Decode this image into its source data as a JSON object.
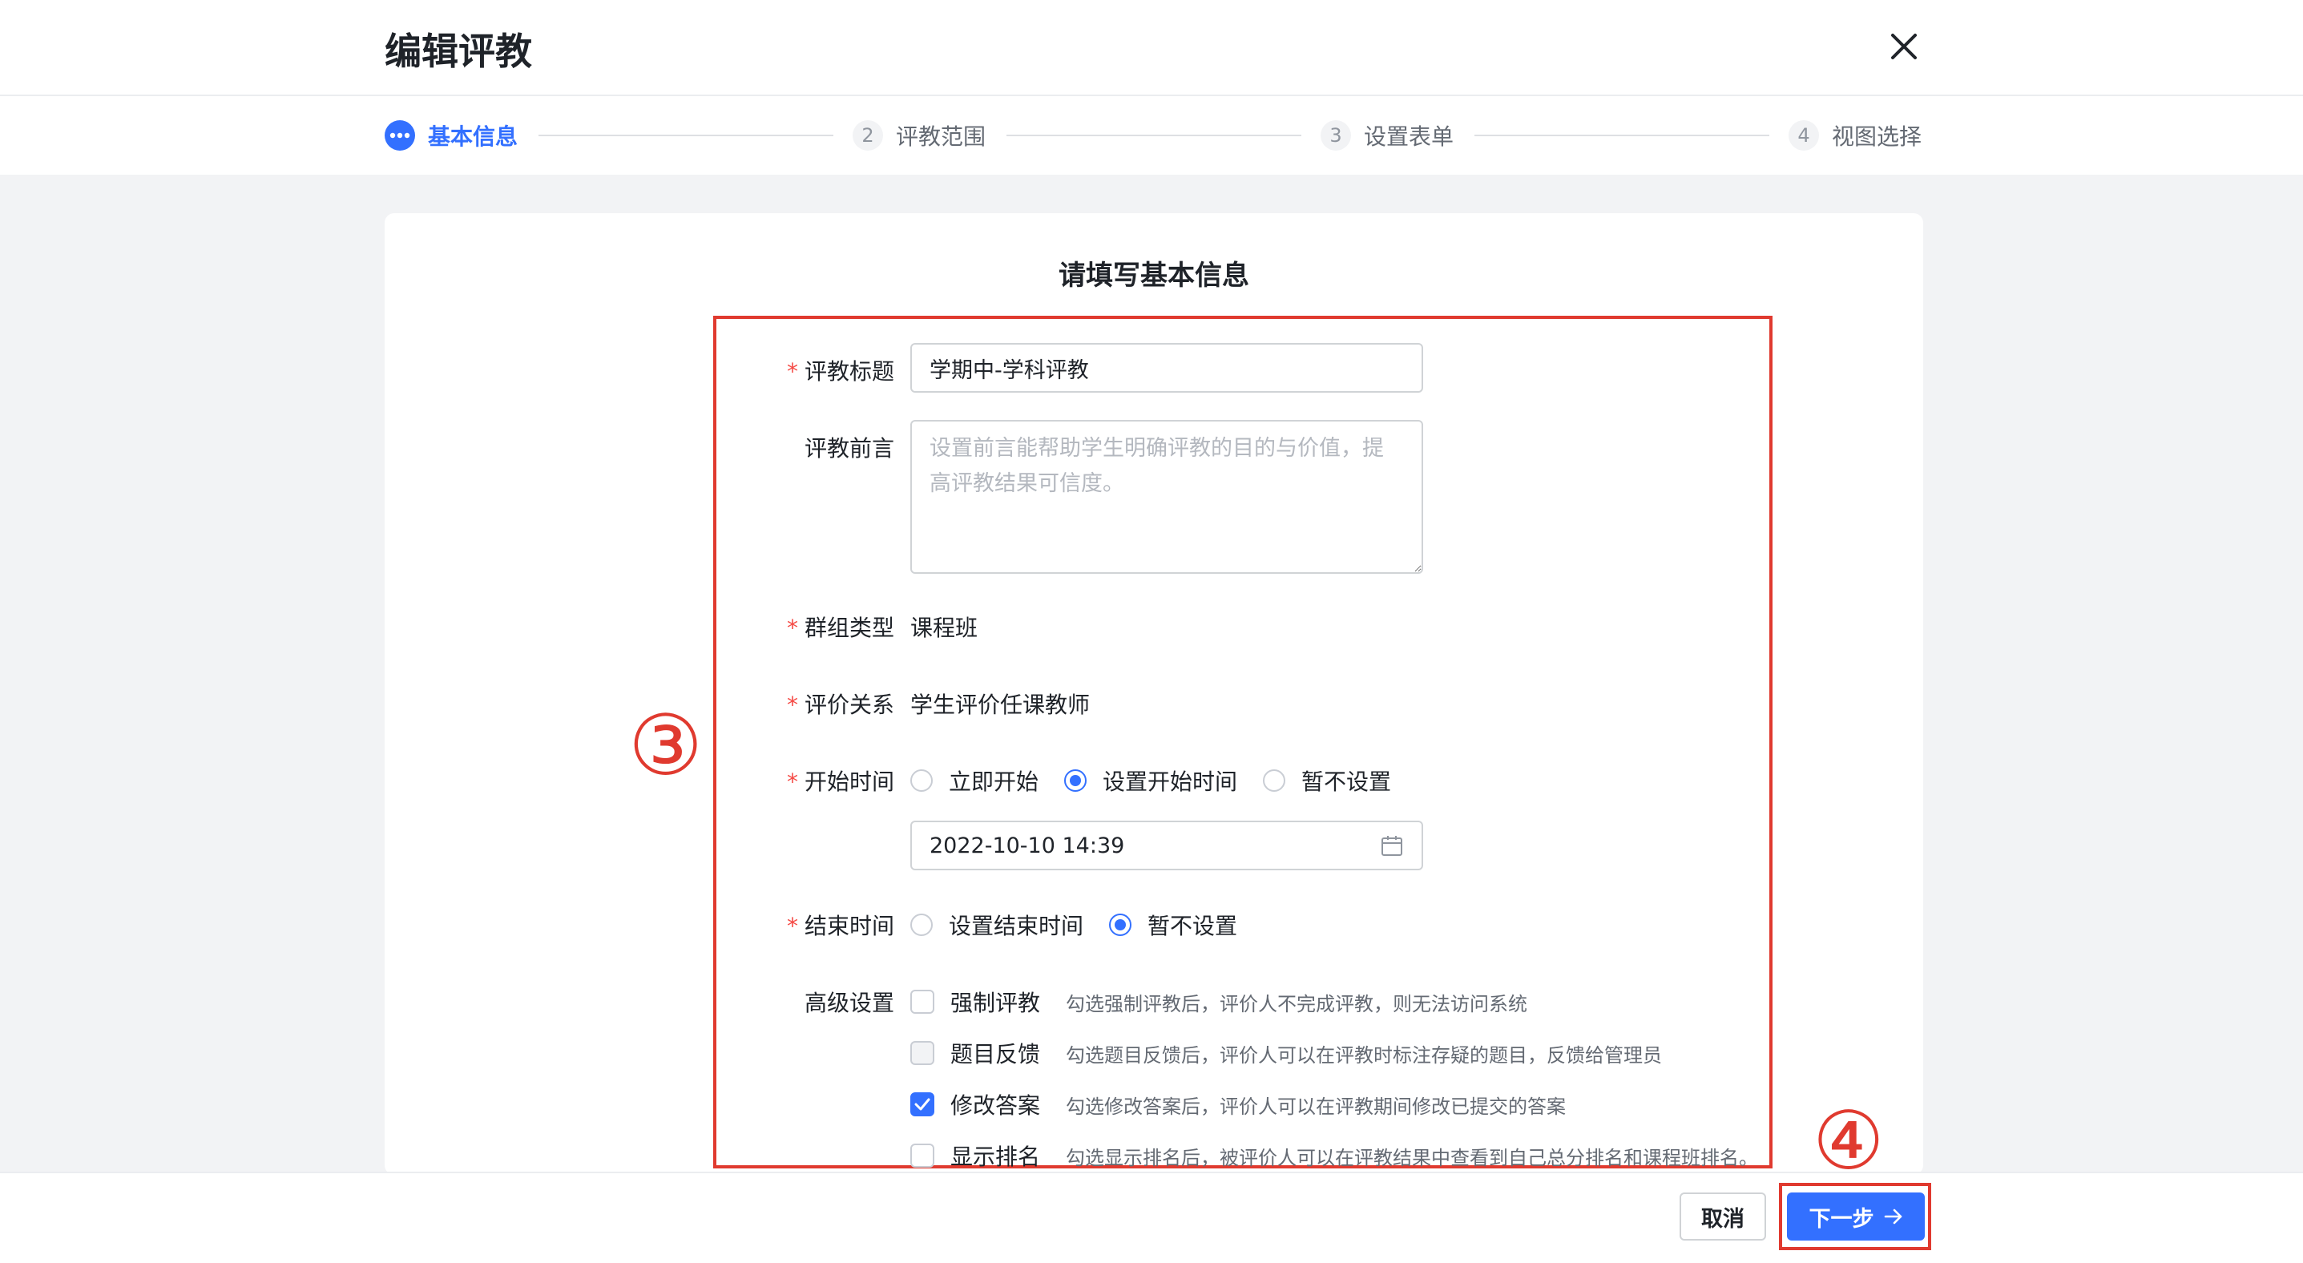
{
  "header": {
    "title": "编辑评教"
  },
  "steps": [
    {
      "num": "",
      "label": "基本信息",
      "active": true
    },
    {
      "num": "2",
      "label": "评教范围",
      "active": false
    },
    {
      "num": "3",
      "label": "设置表单",
      "active": false
    },
    {
      "num": "4",
      "label": "视图选择",
      "active": false
    }
  ],
  "form": {
    "heading": "请填写基本信息",
    "title_field": {
      "label": "评教标题",
      "required": "*",
      "value": "学期中-学科评教"
    },
    "preface_field": {
      "label": "评教前言",
      "placeholder": "设置前言能帮助学生明确评教的目的与价值，提高评教结果可信度。"
    },
    "group_type": {
      "label": "群组类型",
      "required": "*",
      "value": "课程班"
    },
    "relation": {
      "label": "评价关系",
      "required": "*",
      "value": "学生评价任课教师"
    },
    "start_time": {
      "label": "开始时间",
      "required": "*",
      "options": [
        "立即开始",
        "设置开始时间",
        "暂不设置"
      ],
      "selected": "设置开始时间",
      "datetime": "2022-10-10 14:39"
    },
    "end_time": {
      "label": "结束时间",
      "required": "*",
      "options": [
        "设置结束时间",
        "暂不设置"
      ],
      "selected": "暂不设置"
    },
    "advanced": {
      "label": "高级设置",
      "items": [
        {
          "label": "强制评教",
          "desc": "勾选强制评教后，评价人不完成评教，则无法访问系统",
          "checked": false
        },
        {
          "label": "题目反馈",
          "desc": "勾选题目反馈后，评价人可以在评教时标注存疑的题目，反馈给管理员",
          "checked": false
        },
        {
          "label": "修改答案",
          "desc": "勾选修改答案后，评价人可以在评教期间修改已提交的答案",
          "checked": true
        },
        {
          "label": "显示排名",
          "desc": "勾选显示排名后，被评价人可以在评教结果中查看到自己总分排名和课程班排名。",
          "checked": false
        }
      ]
    }
  },
  "annotations": {
    "form_marker": "③",
    "next_marker": "④"
  },
  "footer": {
    "cancel_label": "取消",
    "next_label": "下一步"
  },
  "colors": {
    "primary": "#3370ff",
    "annotation": "#e03a2f",
    "required": "#f54a45"
  },
  "icons": {
    "close": "close-icon",
    "calendar": "calendar-icon",
    "arrow": "arrow-right-icon",
    "more": "more-dots-icon"
  }
}
